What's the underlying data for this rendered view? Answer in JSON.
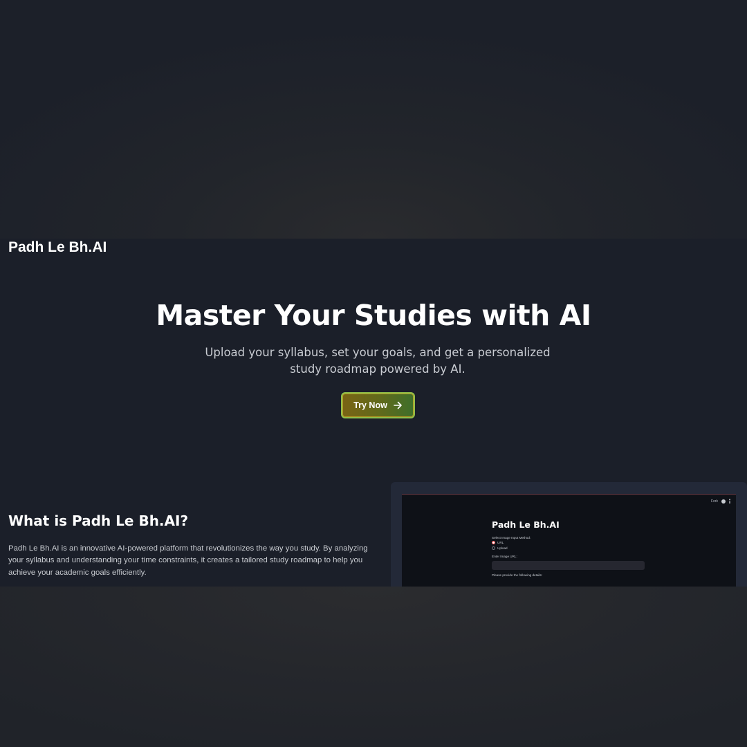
{
  "app": {
    "brand": "Padh Le Bh.AI"
  },
  "hero": {
    "title": "Master Your Studies with AI",
    "subtitle": "Upload your syllabus, set your goals, and get a personalized study roadmap powered by AI.",
    "cta_label": "Try Now",
    "cta_icon": "arrow-right-icon"
  },
  "about": {
    "title": "What is Padh Le Bh.AI?",
    "text": "Padh Le Bh.AI is an innovative AI-powered platform that revolutionizes the way you study. By analyzing your syllabus and understanding your time constraints, it creates a tailored study roadmap to help you achieve your academic goals efficiently."
  },
  "preview": {
    "topbar_text": "Fork",
    "title": "Padh Le Bh.AI",
    "method_label": "Select Image Input Method:",
    "options": [
      "URL",
      "Upload"
    ],
    "selected_option": "URL",
    "url_label": "Enter Image URL:",
    "details_label": "Please provide the following details:"
  },
  "colors": {
    "background": "#1b1f29",
    "cta_border": "#8fc04a",
    "cta_gradient_start": "#7a6414",
    "cta_gradient_end": "#3e6f2a",
    "radio_accent": "#ff4b4b"
  }
}
